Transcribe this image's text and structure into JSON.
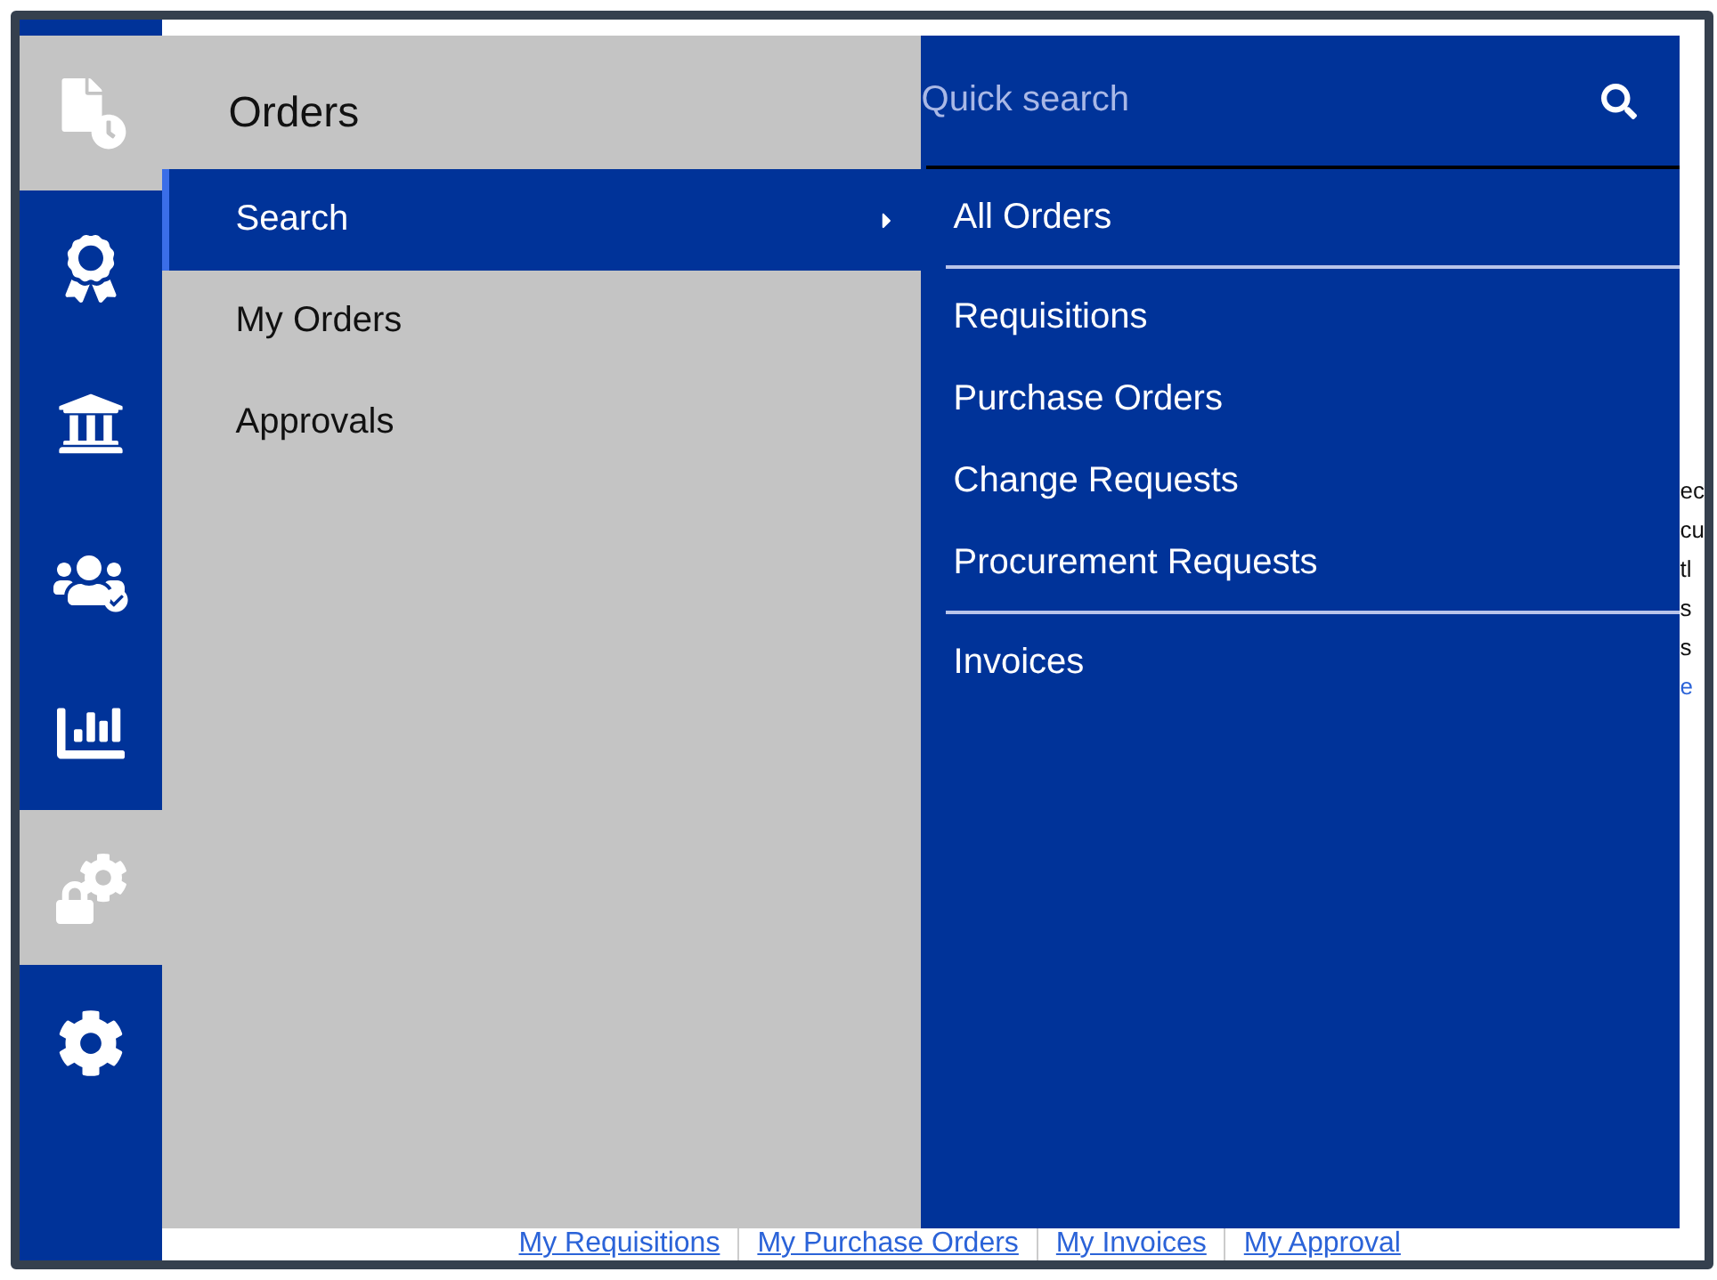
{
  "rail": {
    "items": [
      {
        "kind": "file-clock",
        "selected": true
      },
      {
        "kind": "award",
        "selected": false
      },
      {
        "kind": "bank",
        "selected": false
      },
      {
        "kind": "users",
        "selected": false
      },
      {
        "kind": "chart",
        "selected": false
      },
      {
        "kind": "lock-gear",
        "selected": true
      },
      {
        "kind": "gear",
        "selected": false
      }
    ]
  },
  "menu": {
    "title": "Orders",
    "items": [
      {
        "label": "Search",
        "selected": true,
        "submenu": true
      },
      {
        "label": "My Orders",
        "selected": false,
        "submenu": false
      },
      {
        "label": "Approvals",
        "selected": false,
        "submenu": false
      }
    ]
  },
  "submenu": {
    "search": {
      "placeholder": "Quick search"
    },
    "groups": [
      [
        "All Orders"
      ],
      [
        "Requisitions",
        "Purchase Orders",
        "Change Requests",
        "Procurement Requests"
      ],
      [
        "Invoices"
      ]
    ]
  },
  "page_fragments": [
    "ec",
    "cu",
    "tl",
    "s",
    "s",
    "e"
  ],
  "bottom_links": [
    "My Requisitions",
    "My Purchase Orders",
    "My Invoices",
    "My Approval"
  ]
}
